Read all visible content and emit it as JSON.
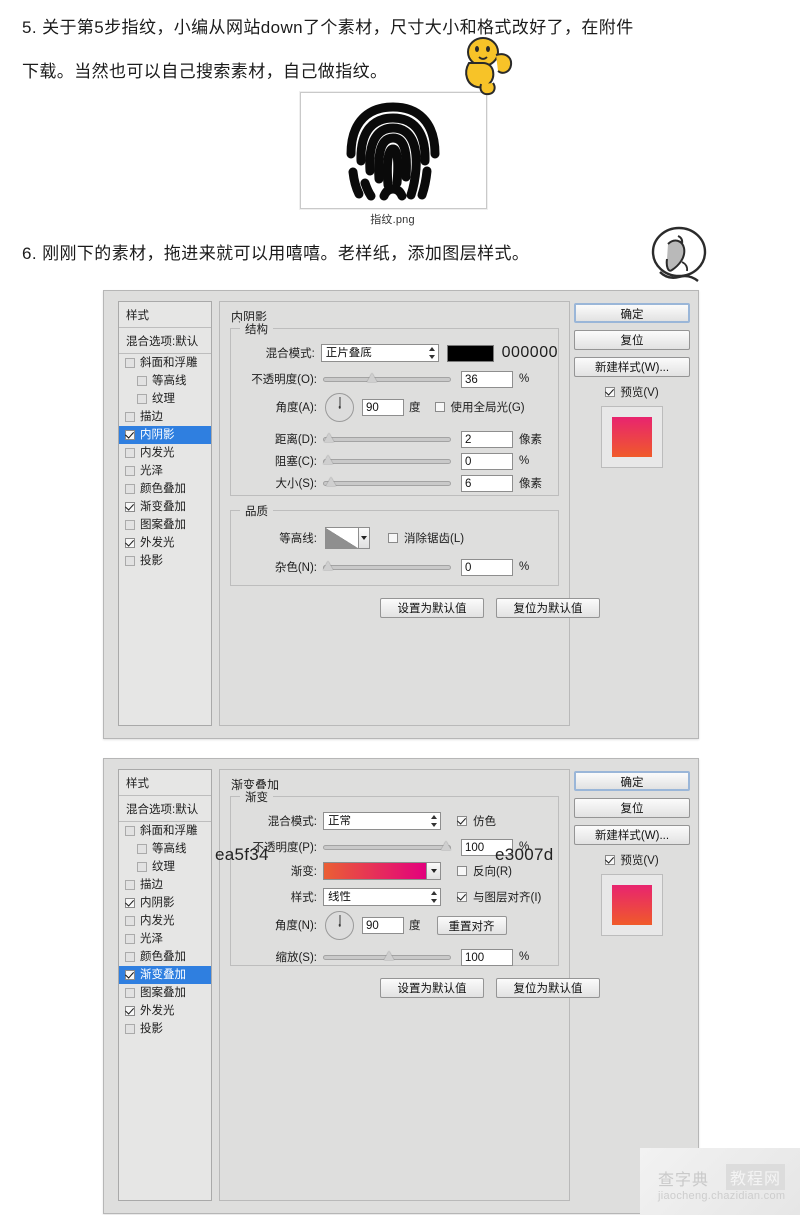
{
  "article": {
    "step5": "5. 关于第5步指纹，小编从网站down了个素材，尺寸大小和格式改好了，在附件\n下载。当然也可以自己搜索素材，自己做指纹。",
    "step6": "6. 刚刚下的素材，拖进来就可以用嘻嘻。老样纸，添加图层样式。",
    "attachment_caption": "指纹.png"
  },
  "styles_panel": {
    "header": "样式",
    "blending_options": "混合选项:默认",
    "items": [
      {
        "label": "斜面和浮雕",
        "checked": false,
        "indent": false,
        "selected": false
      },
      {
        "label": "等高线",
        "checked": false,
        "indent": true,
        "selected": false
      },
      {
        "label": "纹理",
        "checked": false,
        "indent": true,
        "selected": false
      },
      {
        "label": "描边",
        "checked": false,
        "indent": false,
        "selected": false
      },
      {
        "label": "内阴影",
        "checked": true,
        "indent": false,
        "selected": false
      },
      {
        "label": "内发光",
        "checked": false,
        "indent": false,
        "selected": false
      },
      {
        "label": "光泽",
        "checked": false,
        "indent": false,
        "selected": false
      },
      {
        "label": "颜色叠加",
        "checked": false,
        "indent": false,
        "selected": false
      },
      {
        "label": "渐变叠加",
        "checked": true,
        "indent": false,
        "selected": false
      },
      {
        "label": "图案叠加",
        "checked": false,
        "indent": false,
        "selected": false
      },
      {
        "label": "外发光",
        "checked": true,
        "indent": false,
        "selected": false
      },
      {
        "label": "投影",
        "checked": false,
        "indent": false,
        "selected": false
      }
    ]
  },
  "dialog_inner_shadow": {
    "title": "内阴影",
    "selected_style_index": 4,
    "structure": {
      "legend": "结构",
      "blend_mode_label": "混合模式:",
      "blend_mode_value": "正片叠底",
      "color_hex": "000000",
      "color_swatch": "#000000",
      "opacity_label": "不透明度(O):",
      "opacity_value": "36",
      "opacity_unit": "%",
      "angle_label": "角度(A):",
      "angle_value": "90",
      "angle_unit": "度",
      "global_light_label": "使用全局光(G)",
      "global_light_checked": false,
      "distance_label": "距离(D):",
      "distance_value": "2",
      "distance_unit": "像素",
      "choke_label": "阻塞(C):",
      "choke_value": "0",
      "choke_unit": "%",
      "size_label": "大小(S):",
      "size_value": "6",
      "size_unit": "像素"
    },
    "quality": {
      "legend": "品质",
      "contour_label": "等高线:",
      "antialias_label": "消除锯齿(L)",
      "antialias_checked": false,
      "noise_label": "杂色(N):",
      "noise_value": "0",
      "noise_unit": "%"
    },
    "footer": {
      "set_default": "设置为默认值",
      "reset_default": "复位为默认值"
    },
    "right": {
      "ok": "确定",
      "reset": "复位",
      "new_style": "新建样式(W)...",
      "preview_label": "预览(V)",
      "preview_checked": true,
      "preview_top_color": "#e8246f",
      "preview_bottom_color": "#f05a2a"
    }
  },
  "dialog_gradient_overlay": {
    "title": "渐变叠加",
    "selected_style_index": 8,
    "gradient": {
      "legend": "渐变",
      "blend_mode_label": "混合模式:",
      "blend_mode_value": "正常",
      "dither_label": "仿色",
      "dither_checked": true,
      "opacity_label": "不透明度(P):",
      "opacity_value": "100",
      "opacity_unit": "%",
      "gradient_label": "渐变:",
      "gradient_start_hex": "ea5f34",
      "gradient_end_hex": "e3007d",
      "gradient_start_color": "#ea5f34",
      "gradient_end_color": "#e3007d",
      "reverse_label": "反向(R)",
      "reverse_checked": false,
      "style_label": "样式:",
      "style_value": "线性",
      "align_layer_label": "与图层对齐(I)",
      "align_layer_checked": true,
      "angle_label": "角度(N):",
      "angle_value": "90",
      "angle_unit": "度",
      "realign_button": "重置对齐",
      "scale_label": "缩放(S):",
      "scale_value": "100",
      "scale_unit": "%"
    },
    "footer": {
      "set_default": "设置为默认值",
      "reset_default": "复位为默认值"
    },
    "right": {
      "ok": "确定",
      "reset": "复位",
      "new_style": "新建样式(W)...",
      "preview_label": "预览(V)",
      "preview_checked": true,
      "preview_top_color": "#e8246f",
      "preview_bottom_color": "#f05a2a"
    }
  },
  "watermark": {
    "brand_cn": "查字典",
    "brand_box": "教程网",
    "url": "jiaocheng.chazidian.com"
  }
}
